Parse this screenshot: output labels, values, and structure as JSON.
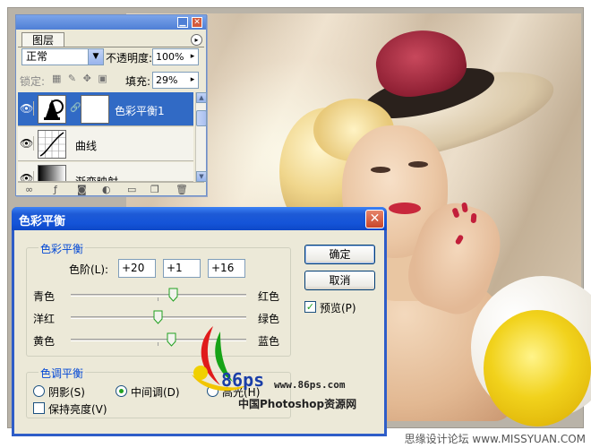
{
  "layers_panel": {
    "tab": "图层",
    "blend_mode": "正常",
    "opacity_label": "不透明度:",
    "opacity_value": "100%",
    "lock_label": "锁定:",
    "fill_label": "填充:",
    "fill_value": "29%",
    "layers": [
      {
        "name": "色彩平衡1",
        "selected": true
      },
      {
        "name": "曲线",
        "selected": false
      },
      {
        "name": "渐变映射",
        "selected": false
      }
    ]
  },
  "dialog": {
    "title": "色彩平衡",
    "close": "✕",
    "color_balance_legend": "色彩平衡",
    "levels_label": "色阶(L):",
    "levels": [
      "+20",
      "+1",
      "+16"
    ],
    "sliders": [
      {
        "left": "青色",
        "right": "红色",
        "value": 20
      },
      {
        "left": "洋红",
        "right": "绿色",
        "value": 1
      },
      {
        "left": "黄色",
        "right": "蓝色",
        "value": 16
      }
    ],
    "tone_legend": "色调平衡",
    "tones": [
      "阴影(S)",
      "中间调(D)",
      "高光(H)"
    ],
    "selected_tone": "中间调(D)",
    "preserve_luminosity": "保持亮度(V)",
    "preserve_checked": false,
    "ok": "确定",
    "cancel": "取消",
    "preview": "预览(P)",
    "preview_checked": true
  },
  "watermark": {
    "logo": "86ps",
    "url": "www.86ps.com",
    "site_name": "中国Photoshop资源网"
  },
  "footer": "思缘设计论坛 www.MISSYUAN.COM"
}
